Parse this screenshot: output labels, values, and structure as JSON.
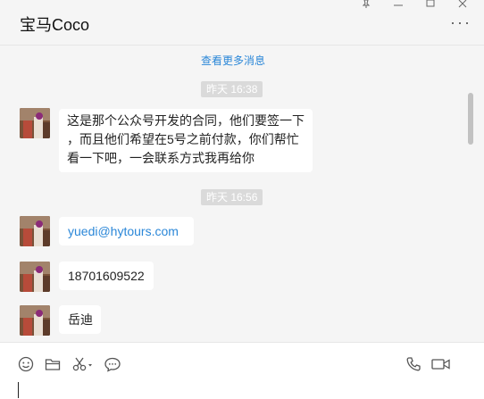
{
  "header": {
    "title": "宝马Coco",
    "more_label": "···"
  },
  "chat": {
    "history_link": "查看更多消息",
    "timestamps": [
      "昨天 16:38",
      "昨天 16:56"
    ],
    "messages": [
      {
        "lines": [
          "这是那个公众号开发的合同，他们要签一下",
          "，而且他们希望在5号之前付款，你们帮忙",
          "看一下吧，一会联系方式我再给你"
        ]
      },
      {
        "text": "yuedi@hytours.com"
      },
      {
        "text": "18701609522"
      },
      {
        "text": "岳迪"
      }
    ]
  },
  "colors": {
    "link": "#2b87d8",
    "background": "#f5f5f5",
    "timestamp_bg": "#dadada"
  },
  "icons": [
    "pin-icon",
    "minimize-icon",
    "maximize-icon",
    "close-icon",
    "more-icon",
    "emoji-icon",
    "folder-icon",
    "scissors-icon",
    "chat-bubble-icon",
    "phone-icon",
    "video-icon"
  ]
}
